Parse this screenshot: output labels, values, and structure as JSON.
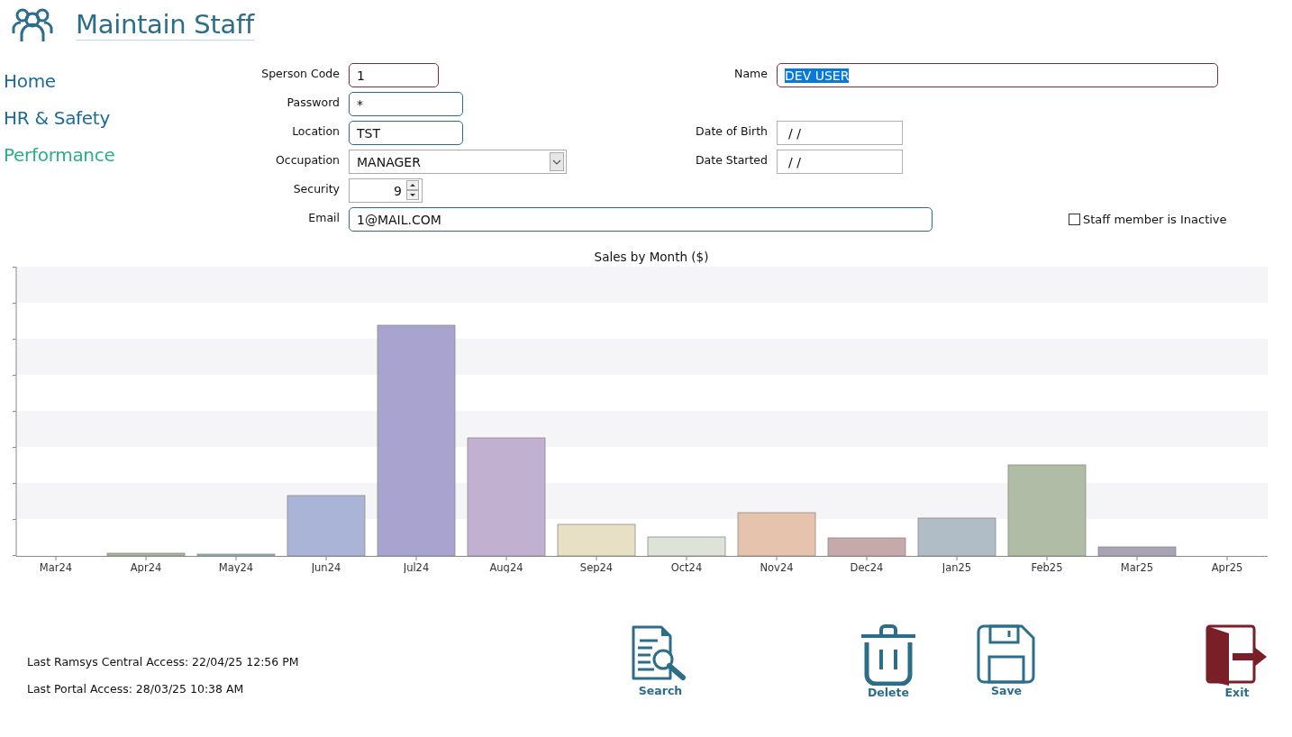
{
  "header": {
    "title": "Maintain Staff"
  },
  "nav": [
    {
      "label": "Home",
      "selected": false
    },
    {
      "label": "HR & Safety",
      "selected": false
    },
    {
      "label": "Performance",
      "selected": true
    }
  ],
  "fields": {
    "sperson_code": {
      "label": "Sperson Code",
      "value": "1",
      "kind": "required"
    },
    "name": {
      "label": "Name",
      "value": "DEV USER",
      "kind": "required",
      "highlighted": true
    },
    "password": {
      "label": "Password",
      "value": "*",
      "kind": "text"
    },
    "location": {
      "label": "Location",
      "value": "TST",
      "kind": "text"
    },
    "date_of_birth": {
      "label": "Date of Birth",
      "value": " /  /",
      "kind": "date"
    },
    "occupation": {
      "label": "Occupation",
      "value": "MANAGER",
      "kind": "select"
    },
    "date_started": {
      "label": "Date Started",
      "value": " /  /",
      "kind": "date"
    },
    "security": {
      "label": "Security",
      "value": "9",
      "kind": "spin"
    },
    "email": {
      "label": "Email",
      "value": "1@MAIL.COM",
      "kind": "text"
    }
  },
  "inactive": {
    "label": "Staff member is Inactive",
    "checked": false
  },
  "chart": {
    "title": "Sales by Month ($)",
    "months": [
      "Mar24",
      "Apr24",
      "May24",
      "Jun24",
      "Jul24",
      "Aug24",
      "Sep24",
      "Oct24",
      "Nov24",
      "Dec24",
      "Jan25",
      "Feb25",
      "Mar25",
      "Apr25"
    ]
  },
  "access": [
    "Last Ramsys Central Access: 22/04/25 12:56 PM",
    "Last Portal Access: 28/03/25 10:38 AM"
  ],
  "buttons": [
    {
      "label": "Search",
      "kind": "search"
    },
    {
      "label": "Delete",
      "kind": "delete"
    },
    {
      "label": "Save",
      "kind": "save"
    },
    {
      "label": "Exit",
      "kind": "exit"
    }
  ]
}
